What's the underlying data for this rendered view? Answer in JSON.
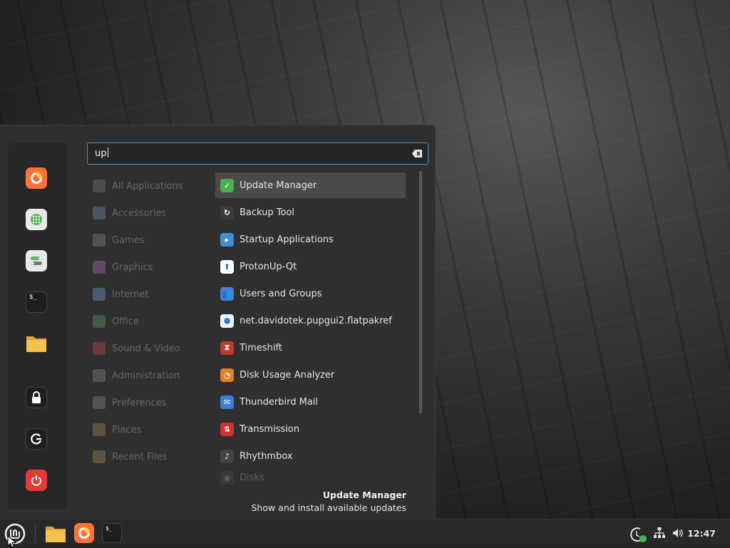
{
  "search": {
    "query": "up"
  },
  "categories": [
    {
      "name": "cat-all-applications",
      "label": "All Applications",
      "icon": "grid-icon",
      "color": "#777777"
    },
    {
      "name": "cat-accessories",
      "label": "Accessories",
      "icon": "scissors-icon",
      "color": "#6f8fb5"
    },
    {
      "name": "cat-games",
      "label": "Games",
      "icon": "gamepad-icon",
      "color": "#888888"
    },
    {
      "name": "cat-graphics",
      "label": "Graphics",
      "icon": "palette-icon",
      "color": "#b06bb0"
    },
    {
      "name": "cat-internet",
      "label": "Internet",
      "icon": "cloud-icon",
      "color": "#6fa0d0"
    },
    {
      "name": "cat-office",
      "label": "Office",
      "icon": "spreadsheet-icon",
      "color": "#5f9a5f"
    },
    {
      "name": "cat-sound-video",
      "label": "Sound & Video",
      "icon": "play-icon",
      "color": "#c04a4a"
    },
    {
      "name": "cat-administration",
      "label": "Administration",
      "icon": "toggles-icon",
      "color": "#888888"
    },
    {
      "name": "cat-preferences",
      "label": "Preferences",
      "icon": "toggles-icon",
      "color": "#888888"
    },
    {
      "name": "cat-places",
      "label": "Places",
      "icon": "folder-icon",
      "color": "#a38a55"
    },
    {
      "name": "cat-recent-files",
      "label": "Recent Files",
      "icon": "folder-clock-icon",
      "color": "#a38a55"
    }
  ],
  "apps": [
    {
      "name": "app-update-manager",
      "label": "Update Manager",
      "icon": "shield-icon",
      "color": "#4caf50",
      "glyph": "✓",
      "selected": true
    },
    {
      "name": "app-backup-tool",
      "label": "Backup Tool",
      "icon": "backup-icon",
      "color": "#3a3a3a",
      "glyph": "↻"
    },
    {
      "name": "app-startup-applications",
      "label": "Startup Applications",
      "icon": "startup-icon",
      "color": "#3d8fd6",
      "glyph": "▸"
    },
    {
      "name": "app-protonup-qt",
      "label": "ProtonUp-Qt",
      "icon": "protonup-icon",
      "color": "#ffffff",
      "glyph": "⬆"
    },
    {
      "name": "app-users-and-groups",
      "label": "Users and Groups",
      "icon": "users-icon",
      "color": "#4a7fd0",
      "glyph": "👥"
    },
    {
      "name": "app-pupgui2-flatpakref",
      "label": "net.davidotek.pupgui2.flatpakref",
      "icon": "package-icon",
      "color": "#f2f2f2",
      "glyph": "⬢"
    },
    {
      "name": "app-timeshift",
      "label": "Timeshift",
      "icon": "timeshift-icon",
      "color": "#c0392b",
      "glyph": "⧗"
    },
    {
      "name": "app-disk-usage-analyzer",
      "label": "Disk Usage Analyzer",
      "icon": "pie-icon",
      "color": "#e67e22",
      "glyph": "◔"
    },
    {
      "name": "app-thunderbird-mail",
      "label": "Thunderbird Mail",
      "icon": "mail-icon",
      "color": "#3b7fd4",
      "glyph": "✉"
    },
    {
      "name": "app-transmission",
      "label": "Transmission",
      "icon": "transmission-icon",
      "color": "#d32f2f",
      "glyph": "⇅"
    },
    {
      "name": "app-rhythmbox",
      "label": "Rhythmbox",
      "icon": "music-icon",
      "color": "#444444",
      "glyph": "♪"
    },
    {
      "name": "app-disks",
      "label": "Disks",
      "icon": "disk-icon",
      "color": "#555555",
      "glyph": "◉"
    }
  ],
  "description": {
    "title": "Update Manager",
    "text": "Show and install available updates"
  },
  "favorites": [
    {
      "name": "fav-firefox",
      "icon": "firefox-icon",
      "color": "#ff7139"
    },
    {
      "name": "fav-software-manager",
      "icon": "software-manager-icon",
      "color": "#e9e9e9"
    },
    {
      "name": "fav-system-settings",
      "icon": "settings-toggles-icon",
      "color": "#e9e9e9"
    },
    {
      "name": "fav-terminal",
      "icon": "terminal-icon",
      "color": "#1e1e1e"
    },
    {
      "name": "fav-files",
      "icon": "folder-icon",
      "color": "#f6c24f"
    },
    {
      "name": "fav-lock-screen",
      "icon": "lock-icon",
      "color": "#1e1e1e"
    },
    {
      "name": "fav-logout",
      "icon": "logout-icon",
      "color": "#1e1e1e"
    },
    {
      "name": "fav-shutdown",
      "icon": "power-icon",
      "color": "#e53935"
    }
  ],
  "panel": {
    "clock": "12:47",
    "launchers": [
      {
        "name": "panel-files",
        "icon": "folder-icon"
      },
      {
        "name": "panel-firefox",
        "icon": "firefox-icon"
      },
      {
        "name": "panel-terminal",
        "icon": "terminal-icon"
      }
    ],
    "tray": [
      "update-manager-tray-icon",
      "network-icon",
      "volume-icon"
    ],
    "terminal_glyph": "$_"
  }
}
